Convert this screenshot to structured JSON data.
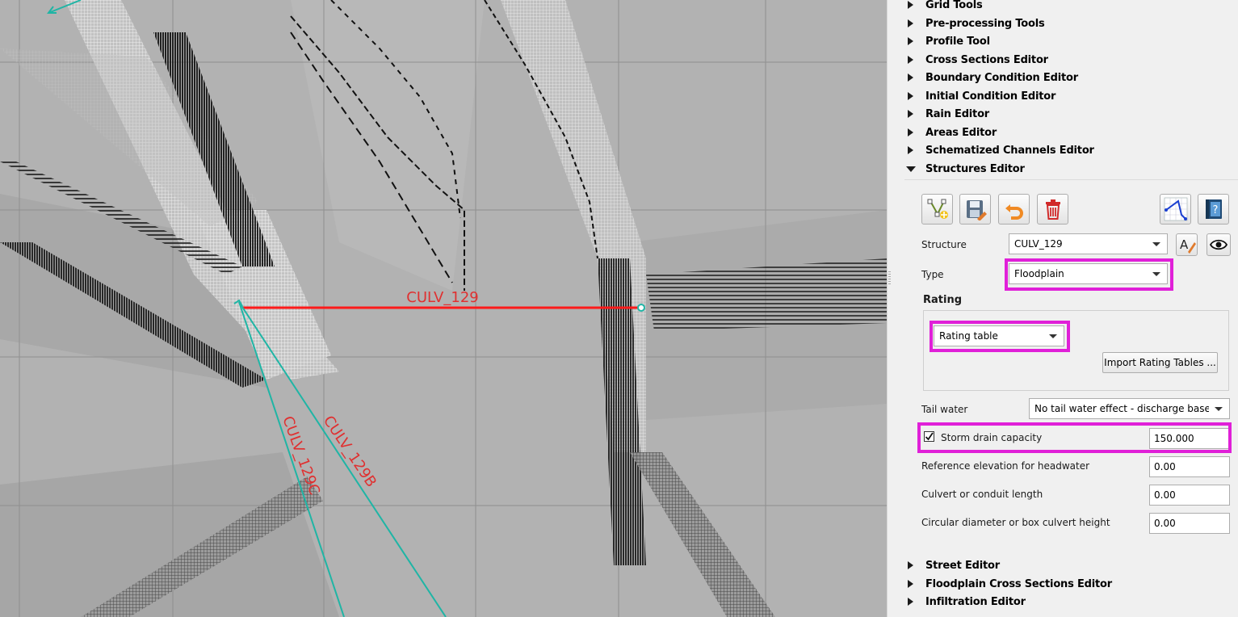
{
  "map": {
    "labels": {
      "main": "CULV_129",
      "b": "CULV_129B",
      "c": "CULV_129C"
    },
    "colors": {
      "background": "#b0b0b0",
      "selected_line": "#ff1a1a",
      "structure_line": "#1fb5a5",
      "label": "#e03030"
    }
  },
  "tree": {
    "items": [
      {
        "label": "Grid Tools",
        "expanded": false
      },
      {
        "label": "Pre-processing Tools",
        "expanded": false
      },
      {
        "label": "Profile Tool",
        "expanded": false
      },
      {
        "label": "Cross Sections Editor",
        "expanded": false
      },
      {
        "label": "Boundary Condition Editor",
        "expanded": false
      },
      {
        "label": "Initial Condition Editor",
        "expanded": false
      },
      {
        "label": "Rain Editor",
        "expanded": false
      },
      {
        "label": "Areas Editor",
        "expanded": false
      },
      {
        "label": "Schematized Channels Editor",
        "expanded": false
      },
      {
        "label": "Structures Editor",
        "expanded": true
      }
    ],
    "after": [
      {
        "label": "Street Editor",
        "expanded": false
      },
      {
        "label": "Floodplain Cross Sections Editor",
        "expanded": false
      },
      {
        "label": "Infiltration Editor",
        "expanded": false
      }
    ]
  },
  "structures_editor": {
    "toolbar": {
      "add_icon": "add-structure-icon",
      "save_icon": "save-icon",
      "undo_icon": "undo-icon",
      "delete_icon": "trash-icon",
      "profile_icon": "profile-chart-icon",
      "help_icon": "help-book-icon"
    },
    "structure_label": "Structure",
    "structure_value": "CULV_129",
    "type_label": "Type",
    "type_value": "Floodplain",
    "rating_label": "Rating",
    "rating_value": "Rating table",
    "import_button": "Import Rating Tables ...",
    "tailwater_label": "Tail water",
    "tailwater_value": "No tail water effect - discharge based c",
    "storm_drain_label": "Storm drain capacity",
    "storm_drain_checked": true,
    "storm_drain_value": "150.000",
    "ref_elev_label": "Reference elevation for headwater",
    "ref_elev_value": "0.00",
    "culvert_length_label": "Culvert or conduit length",
    "culvert_length_value": "0.00",
    "diameter_label": "Circular diameter or box culvert height",
    "diameter_value": "0.00",
    "highlight_color": "#e020d8"
  }
}
